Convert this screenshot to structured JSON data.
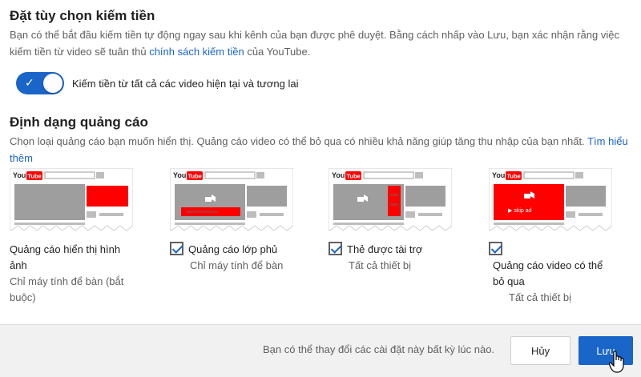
{
  "monetization": {
    "title": "Đặt tùy chọn kiếm tiền",
    "desc_before_link": "Bạn có thể bắt đầu kiếm tiền tự động ngay sau khi kênh của bạn được phê duyệt. Bằng cách nhấp vào Lưu, bạn xác nhận rằng việc kiếm tiền từ video sẽ tuân thủ ",
    "desc_link": "chính sách kiếm tiền",
    "desc_after_link": " của YouTube.",
    "toggle_label": "Kiếm tiền từ tất cả các video hiện tại và tương lai",
    "toggle_on": true
  },
  "ad_formats": {
    "title": "Định dạng quảng cáo",
    "desc": "Chọn loại quảng cáo bạn muốn hiển thị. Quảng cáo video có thể bỏ qua có nhiều khả năng giúp tăng thu nhập của bạn nhất. ",
    "desc_link": "Tìm hiểu thêm",
    "thumb_logo_text": "You",
    "thumb_logo_tube": "Tube",
    "skip_ad_label": "▶ skip ad",
    "items": [
      {
        "name_line1": "Quảng cáo hiển thị hình",
        "name_line2": "ảnh",
        "sub_line1": "Chỉ máy tính để bàn (bắt",
        "sub_line2": "buộc)",
        "checkbox": false
      },
      {
        "name": "Quảng cáo lớp phủ",
        "sub": "Chỉ máy tính để bàn",
        "checkbox": true,
        "checked": true
      },
      {
        "name": "Thẻ được tài trợ",
        "sub": "Tất cả thiết bị",
        "checkbox": true,
        "checked": true
      },
      {
        "name_line1": "Quảng cáo video có thể",
        "name_line2": "bỏ qua",
        "sub": "Tất cả thiết bị",
        "checkbox": true,
        "checked": true
      }
    ]
  },
  "footer": {
    "note": "Bạn có thể thay đổi các cài đặt này bất kỳ lúc nào.",
    "cancel_label": "Hủy",
    "save_label": "Lưu"
  },
  "colors": {
    "accent": "#1a65c8",
    "youtube_red": "#ff0000",
    "placeholder_gray": "#9e9e9e"
  }
}
